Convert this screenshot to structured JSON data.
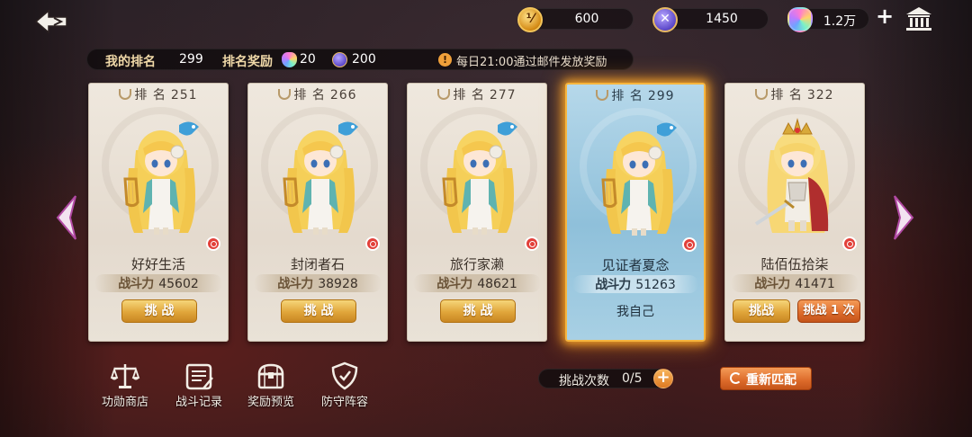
{
  "top_bar": {
    "currencies": [
      {
        "name": "honor-coin",
        "value": "600",
        "icon": "honor-coin-icon"
      },
      {
        "name": "arena-token",
        "value": "1450",
        "icon": "arena-token-icon"
      },
      {
        "name": "rainbow-gem",
        "value": "1.2万",
        "icon": "rainbow-gem-icon"
      }
    ],
    "plus": "+"
  },
  "rank_bar": {
    "my_rank_label": "我的排名",
    "my_rank": "299",
    "reward_label": "排名奖励",
    "reward_gem": "20",
    "reward_token": "200",
    "notice": "每日21:00通过邮件发放奖励",
    "notice_icon": "!"
  },
  "rank_word": "排 名",
  "power_label": "战斗力",
  "cards": [
    {
      "rank": "251",
      "name": "好好生活",
      "power": "45602",
      "button": "挑 战"
    },
    {
      "rank": "266",
      "name": "封闭者石",
      "power": "38928",
      "button": "挑 战"
    },
    {
      "rank": "277",
      "name": "旅行家濑",
      "power": "48621",
      "button": "挑 战"
    },
    {
      "rank": "299",
      "name": "见证者夏念",
      "power": "51263",
      "self_tag": "我自己"
    },
    {
      "rank": "322",
      "name": "陆佰伍拾柒",
      "power": "41471",
      "button": "挑战",
      "button2": "挑战 1 次"
    }
  ],
  "bottom_nav": [
    {
      "label": "功勋商店",
      "icon": "scales-icon"
    },
    {
      "label": "战斗记录",
      "icon": "scroll-icon"
    },
    {
      "label": "奖励预览",
      "icon": "treasure-chest-icon"
    },
    {
      "label": "防守阵容",
      "icon": "shield-icon"
    }
  ],
  "challenge": {
    "label": "挑战次数",
    "count": "0/5",
    "plus": "+"
  },
  "refresh_button": "重新匹配",
  "colors": {
    "gold_button": "#e0a53a",
    "orange_button": "#dc6a2a",
    "self_card": "#8fc0da",
    "glow": "#f6b53e"
  }
}
